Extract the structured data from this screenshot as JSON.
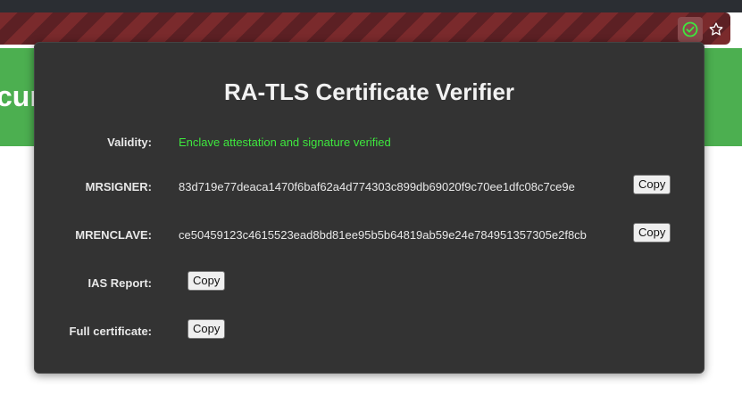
{
  "browser": {
    "extension_icon": "shield-check-icon",
    "bookmark_icon": "star-icon",
    "accent_color": "#3ee83e"
  },
  "page": {
    "banner_text": "cur",
    "banner_color": "#4caf50"
  },
  "popup": {
    "title": "RA-TLS Certificate Verifier",
    "rows": {
      "validity": {
        "label": "Validity:",
        "value": "Enclave attestation and signature verified"
      },
      "mrsigner": {
        "label": "MRSIGNER:",
        "value": "83d719e77deaca1470f6baf62a4d774303c899db69020f9c70ee1dfc08c7ce9e",
        "copy_label": "Copy"
      },
      "mrenclave": {
        "label": "MRENCLAVE:",
        "value": "ce50459123c4615523ead8bd81ee95b5b64819ab59e24e784951357305e2f8cb",
        "copy_label": "Copy"
      },
      "ias_report": {
        "label": "IAS Report:",
        "copy_label": "Copy"
      },
      "full_certificate": {
        "label": "Full certificate:",
        "copy_label": "Copy"
      }
    }
  }
}
